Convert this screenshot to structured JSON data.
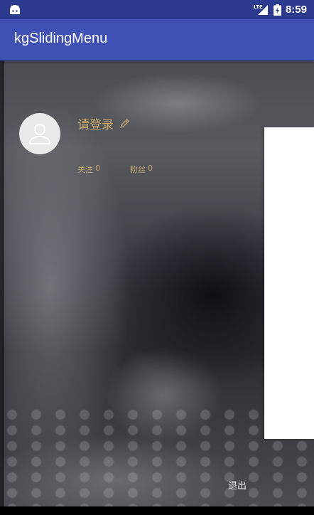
{
  "status_bar": {
    "network_label": "LTE",
    "time": "8:59"
  },
  "app_bar": {
    "title": "kgSlidingMenu"
  },
  "profile": {
    "login_prompt": "请登录",
    "following_label": "关注",
    "following_count": "0",
    "followers_label": "粉丝",
    "followers_count": "0"
  },
  "footer": {
    "logout_label": "退出"
  },
  "colors": {
    "primary": "#3f51b5",
    "primary_dark": "#2c3b8f",
    "accent_text": "#c9a86a"
  }
}
